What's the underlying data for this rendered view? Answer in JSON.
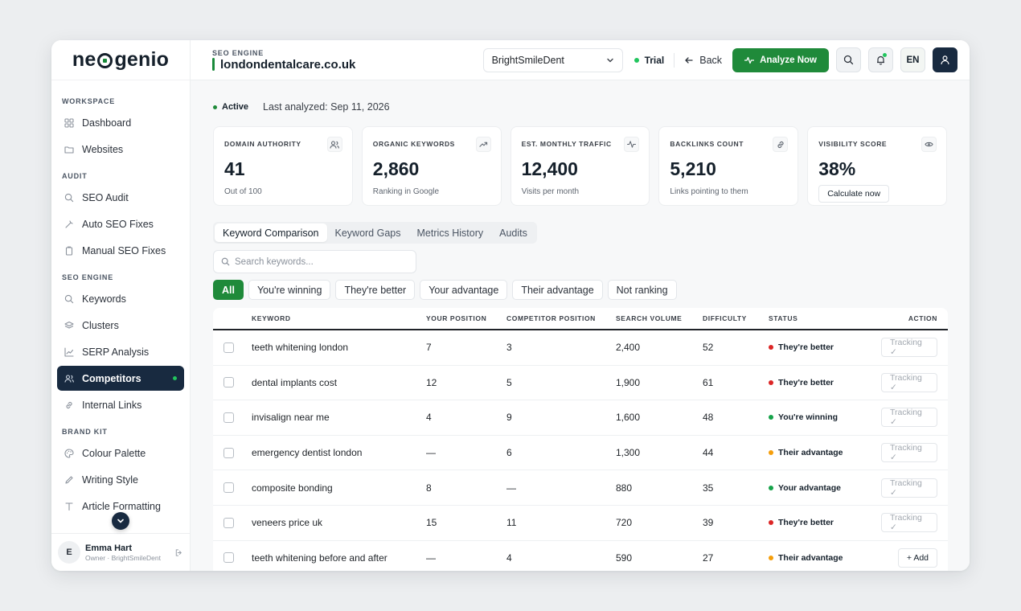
{
  "brand": {
    "logo_left": "ne",
    "logo_right": "genio"
  },
  "sidebar": {
    "sections": [
      {
        "title": "WORKSPACE",
        "items": [
          {
            "label": "Dashboard",
            "icon": "grid-icon"
          },
          {
            "label": "Websites",
            "icon": "folder-icon"
          }
        ]
      },
      {
        "title": "AUDIT",
        "items": [
          {
            "label": "SEO Audit",
            "icon": "search-icon"
          },
          {
            "label": "Auto SEO Fixes",
            "icon": "wand-icon"
          },
          {
            "label": "Manual SEO Fixes",
            "icon": "clipboard-icon"
          }
        ]
      },
      {
        "title": "SEO ENGINE",
        "items": [
          {
            "label": "Keywords",
            "icon": "search-icon"
          },
          {
            "label": "Clusters",
            "icon": "layers-icon"
          },
          {
            "label": "SERP Analysis",
            "icon": "chart-icon"
          },
          {
            "label": "Competitors",
            "icon": "users-icon",
            "active": true
          },
          {
            "label": "Internal Links",
            "icon": "link-icon"
          }
        ]
      },
      {
        "title": "BRAND KIT",
        "items": [
          {
            "label": "Colour Palette",
            "icon": "palette-icon"
          },
          {
            "label": "Writing Style",
            "icon": "pen-icon"
          },
          {
            "label": "Article Formatting",
            "icon": "text-icon"
          }
        ]
      }
    ],
    "user": {
      "initial": "E",
      "name": "Emma Hart",
      "role": "Owner · BrightSmileDent"
    }
  },
  "topbar": {
    "section_label": "SEO ENGINE",
    "domain": "londondentalcare.co.uk",
    "competitor_select": "BrightSmileDent",
    "plan": "Trial",
    "back_label": "Back",
    "analyze_label": "Analyze Now",
    "lang": "EN"
  },
  "status": {
    "state": "Active",
    "last_analyzed": "Last analyzed: Sep 11, 2026"
  },
  "metrics": [
    {
      "label": "DOMAIN AUTHORITY",
      "value": "41",
      "sub": "Out of 100",
      "icon": "users-icon"
    },
    {
      "label": "ORGANIC KEYWORDS",
      "value": "2,860",
      "sub": "Ranking in Google",
      "icon": "trend-up-icon"
    },
    {
      "label": "EST. MONTHLY TRAFFIC",
      "value": "12,400",
      "sub": "Visits per month",
      "icon": "activity-icon"
    },
    {
      "label": "BACKLINKS COUNT",
      "value": "5,210",
      "sub": "Links pointing to them",
      "icon": "link-icon"
    },
    {
      "label": "VISIBILITY SCORE",
      "value": "38%",
      "button": "Calculate now",
      "icon": "eye-icon"
    }
  ],
  "tabs": [
    "Keyword Comparison",
    "Keyword Gaps",
    "Metrics History",
    "Audits"
  ],
  "search": {
    "placeholder": "Search keywords..."
  },
  "filters": [
    "All",
    "You're winning",
    "They're better",
    "Your advantage",
    "Their advantage",
    "Not ranking"
  ],
  "table": {
    "headers": [
      "KEYWORD",
      "YOUR POSITION",
      "COMPETITOR POSITION",
      "SEARCH VOLUME",
      "DIFFICULTY",
      "STATUS",
      "ACTION"
    ],
    "rows": [
      {
        "keyword": "teeth whitening london",
        "your": "7",
        "comp": "3",
        "volume": "2,400",
        "difficulty": "52",
        "status": "They're better",
        "color": "#dc2626",
        "action": "Tracking ✓"
      },
      {
        "keyword": "dental implants cost",
        "your": "12",
        "comp": "5",
        "volume": "1,900",
        "difficulty": "61",
        "status": "They're better",
        "color": "#dc2626",
        "action": "Tracking ✓"
      },
      {
        "keyword": "invisalign near me",
        "your": "4",
        "comp": "9",
        "volume": "1,600",
        "difficulty": "48",
        "status": "You're winning",
        "color": "#16a34a",
        "action": "Tracking ✓"
      },
      {
        "keyword": "emergency dentist london",
        "your": "—",
        "comp": "6",
        "volume": "1,300",
        "difficulty": "44",
        "status": "Their advantage",
        "color": "#f59e0b",
        "action": "Tracking ✓"
      },
      {
        "keyword": "composite bonding",
        "your": "8",
        "comp": "—",
        "volume": "880",
        "difficulty": "35",
        "status": "Your advantage",
        "color": "#16a34a",
        "action": "Tracking ✓"
      },
      {
        "keyword": "veneers price uk",
        "your": "15",
        "comp": "11",
        "volume": "720",
        "difficulty": "39",
        "status": "They're better",
        "color": "#dc2626",
        "action": "Tracking ✓"
      },
      {
        "keyword": "teeth whitening before and after",
        "your": "—",
        "comp": "4",
        "volume": "590",
        "difficulty": "27",
        "status": "Their advantage",
        "color": "#f59e0b",
        "action": "+ Add"
      }
    ]
  }
}
